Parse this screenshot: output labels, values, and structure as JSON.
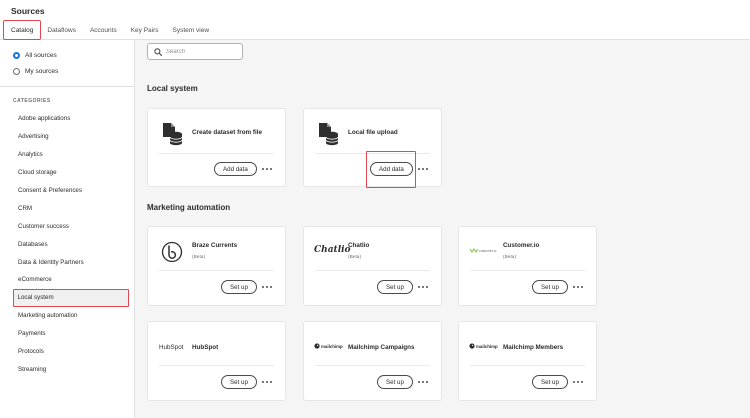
{
  "header": {
    "title": "Sources",
    "tabs": [
      {
        "label": "Catalog"
      },
      {
        "label": "Dataflows"
      },
      {
        "label": "Accounts"
      },
      {
        "label": "Key Pairs"
      },
      {
        "label": "System view"
      }
    ],
    "active_tab": "Catalog"
  },
  "sidebar": {
    "filters": [
      {
        "label": "All sources",
        "checked": true
      },
      {
        "label": "My sources",
        "checked": false
      }
    ],
    "categories_heading": "CATEGORIES",
    "categories": [
      {
        "label": "Adobe applications"
      },
      {
        "label": "Advertising"
      },
      {
        "label": "Analytics"
      },
      {
        "label": "Cloud storage"
      },
      {
        "label": "Consent & Preferences"
      },
      {
        "label": "CRM"
      },
      {
        "label": "Customer success"
      },
      {
        "label": "Databases"
      },
      {
        "label": "Data & Identity Partners"
      },
      {
        "label": "eCommerce"
      },
      {
        "label": "Local system"
      },
      {
        "label": "Marketing automation"
      },
      {
        "label": "Payments"
      },
      {
        "label": "Protocols"
      },
      {
        "label": "Streaming"
      }
    ],
    "selected_category": "Local system"
  },
  "search": {
    "placeholder": "Search",
    "value": ""
  },
  "sections": [
    {
      "title": "Local system",
      "cards": [
        {
          "title": "Create dataset from file",
          "subtitle": "",
          "button": "Add data",
          "icon": "dataset-upload-icon"
        },
        {
          "title": "Local file upload",
          "subtitle": "",
          "button": "Add data",
          "icon": "dataset-upload-icon"
        }
      ]
    },
    {
      "title": "Marketing automation",
      "cards": [
        {
          "title": "Braze Currents",
          "subtitle": "(Beta)",
          "button": "Set up",
          "icon": "braze-logo"
        },
        {
          "title": "Chatlio",
          "subtitle": "(Beta)",
          "button": "Set up",
          "icon": "chatlio-logo",
          "logo_text": "Chatlio"
        },
        {
          "title": "Customer.io",
          "subtitle": "(Beta)",
          "button": "Set up",
          "icon": "customerio-logo",
          "logo_text": "customer.io"
        },
        {
          "title": "HubSpot",
          "subtitle": "",
          "button": "Set up",
          "icon": "hubspot-logo",
          "logo_text": "HubSpot"
        },
        {
          "title": "Mailchimp Campaigns",
          "subtitle": "",
          "button": "Set up",
          "icon": "mailchimp-logo",
          "logo_text": "mailchimp"
        },
        {
          "title": "Mailchimp Members",
          "subtitle": "",
          "button": "Set up",
          "icon": "mailchimp-logo",
          "logo_text": "mailchimp"
        }
      ]
    }
  ],
  "colors": {
    "accent": "#1473e6",
    "highlight": "#e34850",
    "background": "#f5f5f5",
    "card": "#ffffff"
  }
}
